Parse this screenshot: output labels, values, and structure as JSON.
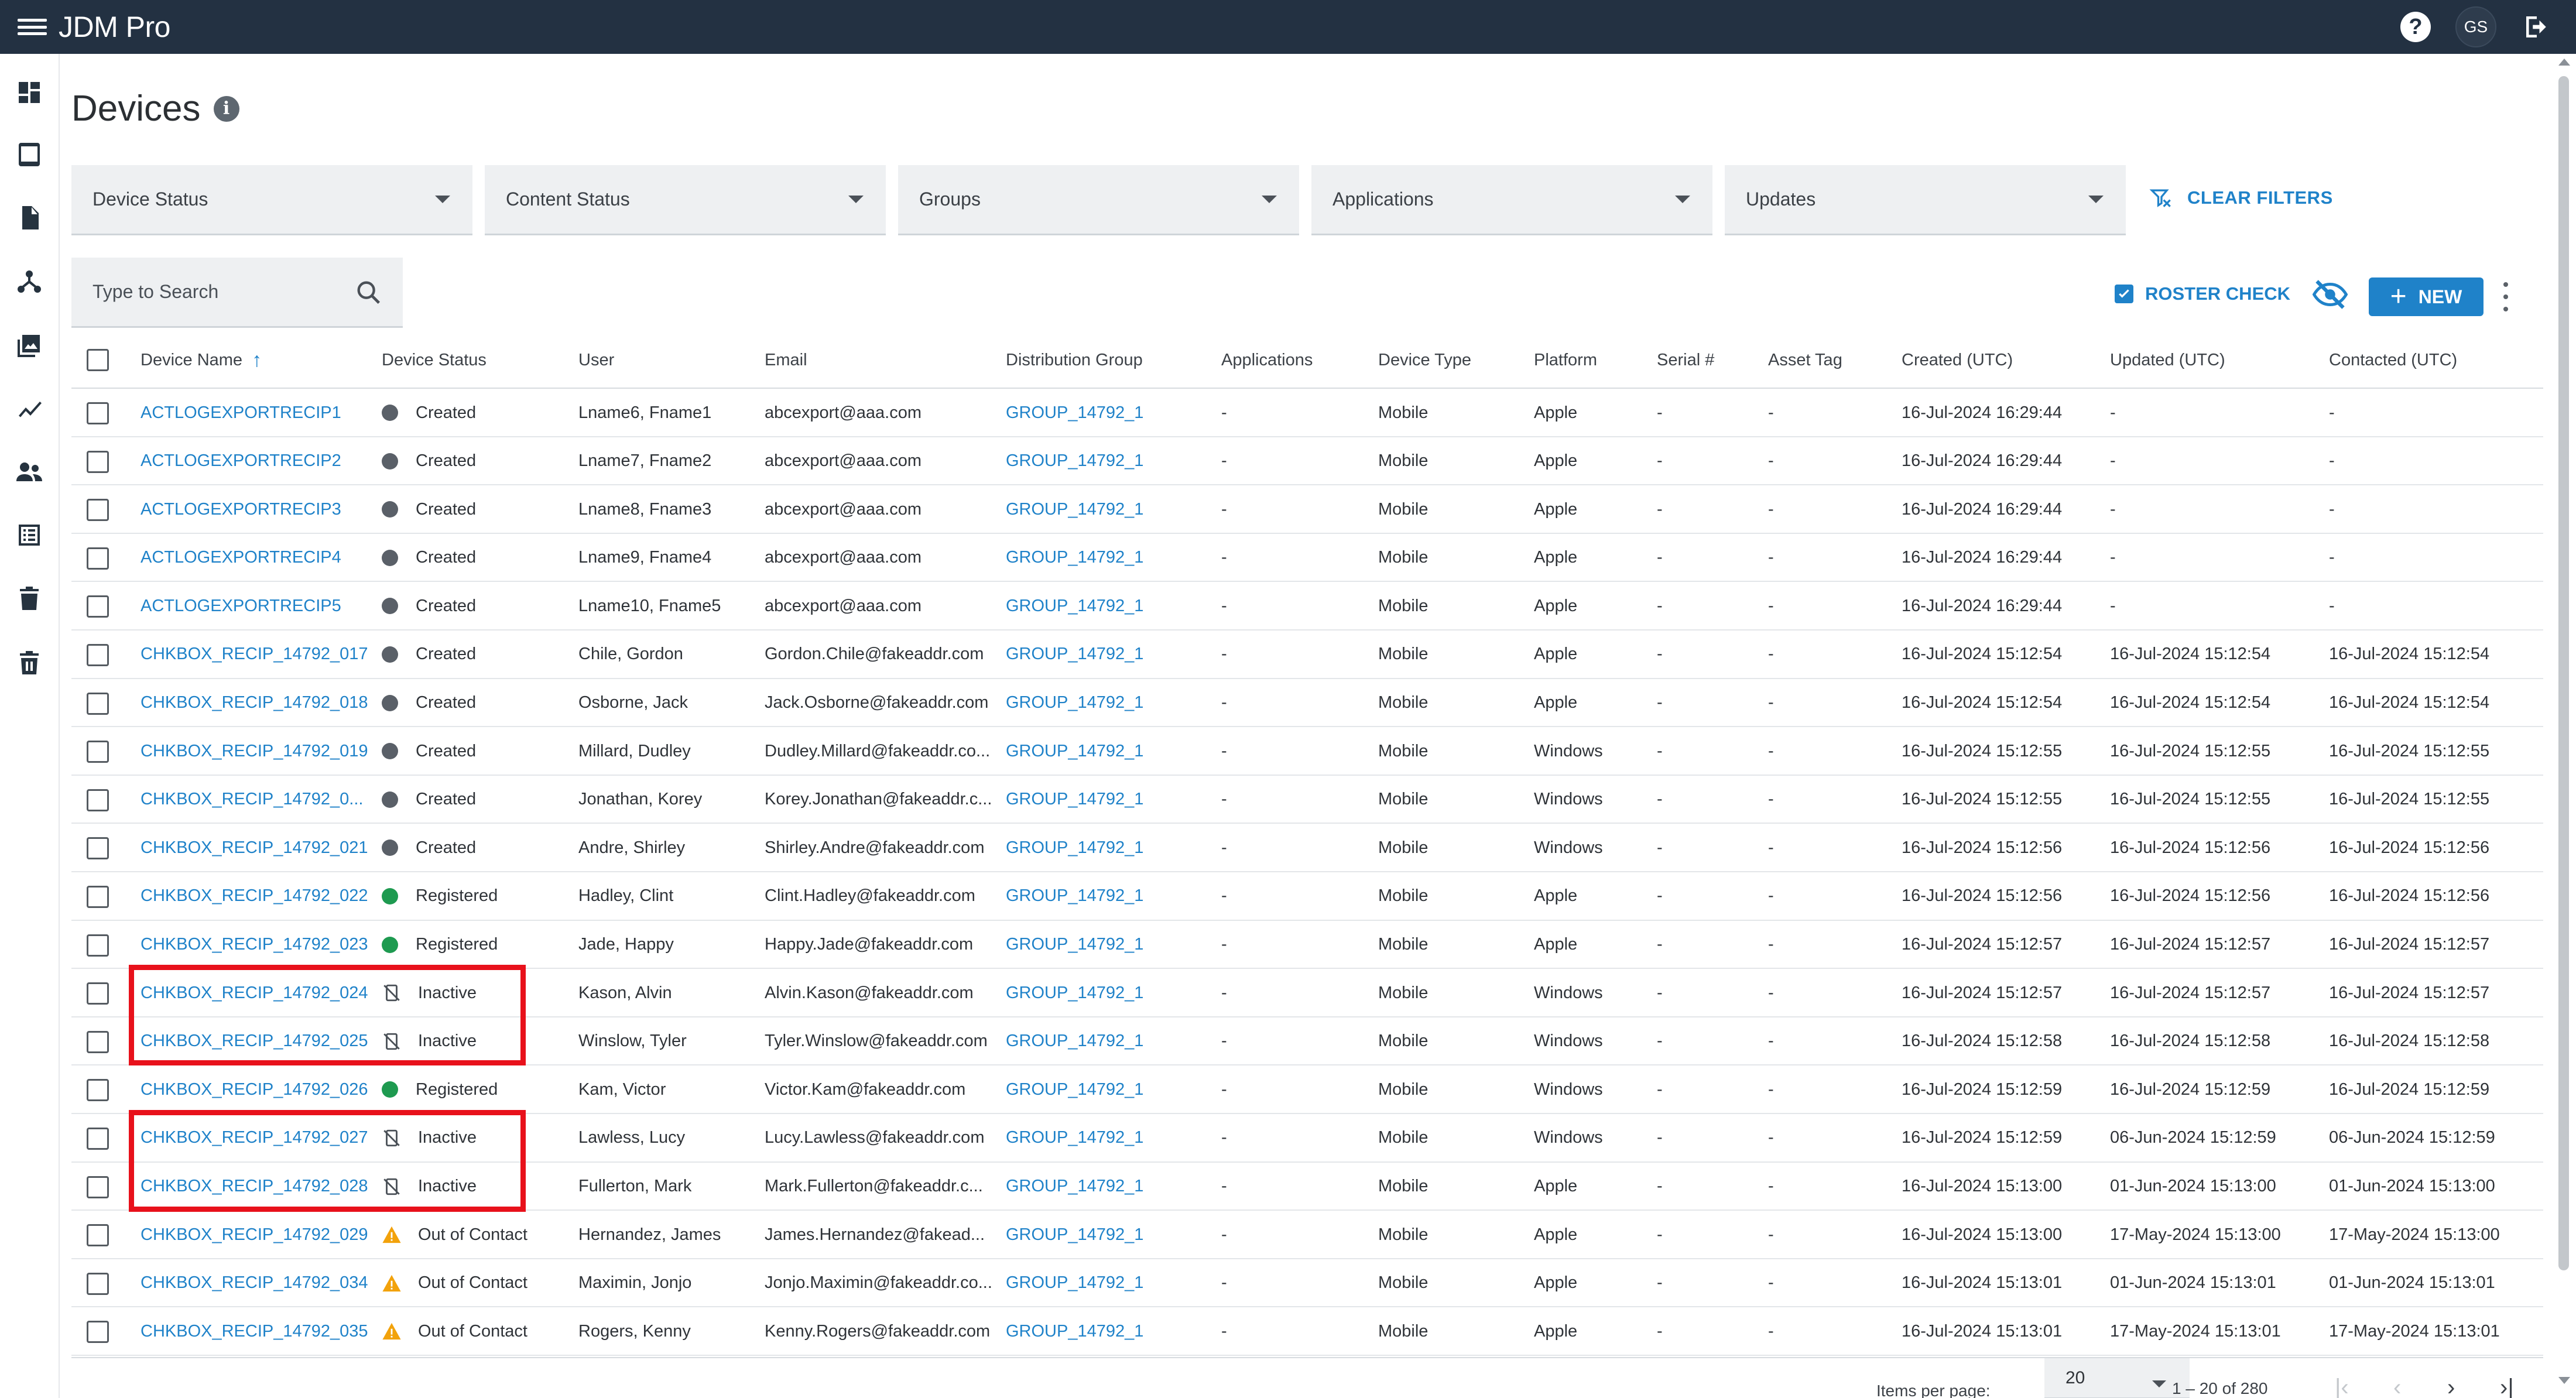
{
  "app": {
    "title": "JDM Pro",
    "avatar_initials": "GS"
  },
  "page": {
    "title": "Devices"
  },
  "filters": [
    {
      "label": "Device Status"
    },
    {
      "label": "Content Status"
    },
    {
      "label": "Groups"
    },
    {
      "label": "Applications"
    },
    {
      "label": "Updates"
    }
  ],
  "clear_filters_label": "CLEAR FILTERS",
  "search": {
    "placeholder": "Type to Search"
  },
  "toolbar": {
    "roster_check_label": "ROSTER CHECK",
    "new_label": "NEW"
  },
  "colors": {
    "accent": "#1f82c9",
    "topbar": "#233142",
    "created": "#5a6068",
    "registered": "#1e9a50",
    "warning": "#f2a20b",
    "highlight": "#e8111b"
  },
  "table": {
    "columns": [
      "Device Name",
      "Device Status",
      "User",
      "Email",
      "Distribution Group",
      "Applications",
      "Device Type",
      "Platform",
      "Serial #",
      "Asset Tag",
      "Created (UTC)",
      "Updated (UTC)",
      "Contacted (UTC)"
    ],
    "rows": [
      {
        "name": "ACTLOGEXPORTRECIP1",
        "status": "Created",
        "status_kind": "created",
        "user": "Lname6, Fname1",
        "email": "abcexport@aaa.com",
        "group": "GROUP_14792_1",
        "apps": "-",
        "type": "Mobile",
        "platform": "Apple",
        "serial": "-",
        "asset": "-",
        "created": "16-Jul-2024 16:29:44",
        "updated": "-",
        "contacted": "-"
      },
      {
        "name": "ACTLOGEXPORTRECIP2",
        "status": "Created",
        "status_kind": "created",
        "user": "Lname7, Fname2",
        "email": "abcexport@aaa.com",
        "group": "GROUP_14792_1",
        "apps": "-",
        "type": "Mobile",
        "platform": "Apple",
        "serial": "-",
        "asset": "-",
        "created": "16-Jul-2024 16:29:44",
        "updated": "-",
        "contacted": "-"
      },
      {
        "name": "ACTLOGEXPORTRECIP3",
        "status": "Created",
        "status_kind": "created",
        "user": "Lname8, Fname3",
        "email": "abcexport@aaa.com",
        "group": "GROUP_14792_1",
        "apps": "-",
        "type": "Mobile",
        "platform": "Apple",
        "serial": "-",
        "asset": "-",
        "created": "16-Jul-2024 16:29:44",
        "updated": "-",
        "contacted": "-"
      },
      {
        "name": "ACTLOGEXPORTRECIP4",
        "status": "Created",
        "status_kind": "created",
        "user": "Lname9, Fname4",
        "email": "abcexport@aaa.com",
        "group": "GROUP_14792_1",
        "apps": "-",
        "type": "Mobile",
        "platform": "Apple",
        "serial": "-",
        "asset": "-",
        "created": "16-Jul-2024 16:29:44",
        "updated": "-",
        "contacted": "-"
      },
      {
        "name": "ACTLOGEXPORTRECIP5",
        "status": "Created",
        "status_kind": "created",
        "user": "Lname10, Fname5",
        "email": "abcexport@aaa.com",
        "group": "GROUP_14792_1",
        "apps": "-",
        "type": "Mobile",
        "platform": "Apple",
        "serial": "-",
        "asset": "-",
        "created": "16-Jul-2024 16:29:44",
        "updated": "-",
        "contacted": "-"
      },
      {
        "name": "CHKBOX_RECIP_14792_017",
        "status": "Created",
        "status_kind": "created",
        "user": "Chile, Gordon",
        "email": "Gordon.Chile@fakeaddr.com",
        "group": "GROUP_14792_1",
        "apps": "-",
        "type": "Mobile",
        "platform": "Apple",
        "serial": "-",
        "asset": "-",
        "created": "16-Jul-2024 15:12:54",
        "updated": "16-Jul-2024 15:12:54",
        "contacted": "16-Jul-2024 15:12:54"
      },
      {
        "name": "CHKBOX_RECIP_14792_018",
        "status": "Created",
        "status_kind": "created",
        "user": "Osborne, Jack",
        "email": "Jack.Osborne@fakeaddr.com",
        "group": "GROUP_14792_1",
        "apps": "-",
        "type": "Mobile",
        "platform": "Apple",
        "serial": "-",
        "asset": "-",
        "created": "16-Jul-2024 15:12:54",
        "updated": "16-Jul-2024 15:12:54",
        "contacted": "16-Jul-2024 15:12:54"
      },
      {
        "name": "CHKBOX_RECIP_14792_019",
        "status": "Created",
        "status_kind": "created",
        "user": "Millard, Dudley",
        "email": "Dudley.Millard@fakeaddr.co...",
        "group": "GROUP_14792_1",
        "apps": "-",
        "type": "Mobile",
        "platform": "Windows",
        "serial": "-",
        "asset": "-",
        "created": "16-Jul-2024 15:12:55",
        "updated": "16-Jul-2024 15:12:55",
        "contacted": "16-Jul-2024 15:12:55"
      },
      {
        "name": "CHKBOX_RECIP_14792_0...",
        "status": "Created",
        "status_kind": "created",
        "user": "Jonathan, Korey",
        "email": "Korey.Jonathan@fakeaddr.c...",
        "group": "GROUP_14792_1",
        "apps": "-",
        "type": "Mobile",
        "platform": "Windows",
        "serial": "-",
        "asset": "-",
        "created": "16-Jul-2024 15:12:55",
        "updated": "16-Jul-2024 15:12:55",
        "contacted": "16-Jul-2024 15:12:55"
      },
      {
        "name": "CHKBOX_RECIP_14792_021",
        "status": "Created",
        "status_kind": "created",
        "user": "Andre, Shirley",
        "email": "Shirley.Andre@fakeaddr.com",
        "group": "GROUP_14792_1",
        "apps": "-",
        "type": "Mobile",
        "platform": "Windows",
        "serial": "-",
        "asset": "-",
        "created": "16-Jul-2024 15:12:56",
        "updated": "16-Jul-2024 15:12:56",
        "contacted": "16-Jul-2024 15:12:56"
      },
      {
        "name": "CHKBOX_RECIP_14792_022",
        "status": "Registered",
        "status_kind": "registered",
        "user": "Hadley, Clint",
        "email": "Clint.Hadley@fakeaddr.com",
        "group": "GROUP_14792_1",
        "apps": "-",
        "type": "Mobile",
        "platform": "Apple",
        "serial": "-",
        "asset": "-",
        "created": "16-Jul-2024 15:12:56",
        "updated": "16-Jul-2024 15:12:56",
        "contacted": "16-Jul-2024 15:12:56"
      },
      {
        "name": "CHKBOX_RECIP_14792_023",
        "status": "Registered",
        "status_kind": "registered",
        "user": "Jade, Happy",
        "email": "Happy.Jade@fakeaddr.com",
        "group": "GROUP_14792_1",
        "apps": "-",
        "type": "Mobile",
        "platform": "Apple",
        "serial": "-",
        "asset": "-",
        "created": "16-Jul-2024 15:12:57",
        "updated": "16-Jul-2024 15:12:57",
        "contacted": "16-Jul-2024 15:12:57"
      },
      {
        "name": "CHKBOX_RECIP_14792_024",
        "status": "Inactive",
        "status_kind": "inactive",
        "user": "Kason, Alvin",
        "email": "Alvin.Kason@fakeaddr.com",
        "group": "GROUP_14792_1",
        "apps": "-",
        "type": "Mobile",
        "platform": "Windows",
        "serial": "-",
        "asset": "-",
        "created": "16-Jul-2024 15:12:57",
        "updated": "16-Jul-2024 15:12:57",
        "contacted": "16-Jul-2024 15:12:57"
      },
      {
        "name": "CHKBOX_RECIP_14792_025",
        "status": "Inactive",
        "status_kind": "inactive",
        "user": "Winslow, Tyler",
        "email": "Tyler.Winslow@fakeaddr.com",
        "group": "GROUP_14792_1",
        "apps": "-",
        "type": "Mobile",
        "platform": "Windows",
        "serial": "-",
        "asset": "-",
        "created": "16-Jul-2024 15:12:58",
        "updated": "16-Jul-2024 15:12:58",
        "contacted": "16-Jul-2024 15:12:58"
      },
      {
        "name": "CHKBOX_RECIP_14792_026",
        "status": "Registered",
        "status_kind": "registered",
        "user": "Kam, Victor",
        "email": "Victor.Kam@fakeaddr.com",
        "group": "GROUP_14792_1",
        "apps": "-",
        "type": "Mobile",
        "platform": "Windows",
        "serial": "-",
        "asset": "-",
        "created": "16-Jul-2024 15:12:59",
        "updated": "16-Jul-2024 15:12:59",
        "contacted": "16-Jul-2024 15:12:59"
      },
      {
        "name": "CHKBOX_RECIP_14792_027",
        "status": "Inactive",
        "status_kind": "inactive",
        "user": "Lawless, Lucy",
        "email": "Lucy.Lawless@fakeaddr.com",
        "group": "GROUP_14792_1",
        "apps": "-",
        "type": "Mobile",
        "platform": "Windows",
        "serial": "-",
        "asset": "-",
        "created": "16-Jul-2024 15:12:59",
        "updated": "06-Jun-2024 15:12:59",
        "contacted": "06-Jun-2024 15:12:59"
      },
      {
        "name": "CHKBOX_RECIP_14792_028",
        "status": "Inactive",
        "status_kind": "inactive",
        "user": "Fullerton, Mark",
        "email": "Mark.Fullerton@fakeaddr.c...",
        "group": "GROUP_14792_1",
        "apps": "-",
        "type": "Mobile",
        "platform": "Apple",
        "serial": "-",
        "asset": "-",
        "created": "16-Jul-2024 15:13:00",
        "updated": "01-Jun-2024 15:13:00",
        "contacted": "01-Jun-2024 15:13:00"
      },
      {
        "name": "CHKBOX_RECIP_14792_029",
        "status": "Out of Contact",
        "status_kind": "warning",
        "user": "Hernandez, James",
        "email": "James.Hernandez@fakead...",
        "group": "GROUP_14792_1",
        "apps": "-",
        "type": "Mobile",
        "platform": "Apple",
        "serial": "-",
        "asset": "-",
        "created": "16-Jul-2024 15:13:00",
        "updated": "17-May-2024 15:13:00",
        "contacted": "17-May-2024 15:13:00"
      },
      {
        "name": "CHKBOX_RECIP_14792_034",
        "status": "Out of Contact",
        "status_kind": "warning",
        "user": "Maximin, Jonjo",
        "email": "Jonjo.Maximin@fakeaddr.co...",
        "group": "GROUP_14792_1",
        "apps": "-",
        "type": "Mobile",
        "platform": "Apple",
        "serial": "-",
        "asset": "-",
        "created": "16-Jul-2024 15:13:01",
        "updated": "01-Jun-2024 15:13:01",
        "contacted": "01-Jun-2024 15:13:01"
      },
      {
        "name": "CHKBOX_RECIP_14792_035",
        "status": "Out of Contact",
        "status_kind": "warning",
        "user": "Rogers, Kenny",
        "email": "Kenny.Rogers@fakeaddr.com",
        "group": "GROUP_14792_1",
        "apps": "-",
        "type": "Mobile",
        "platform": "Apple",
        "serial": "-",
        "asset": "-",
        "created": "16-Jul-2024 15:13:01",
        "updated": "17-May-2024 15:13:01",
        "contacted": "17-May-2024 15:13:01"
      }
    ]
  },
  "pagination": {
    "items_per_page_label": "Items per page:",
    "items_per_page": "20",
    "range": "1 – 20 of 280"
  },
  "icons": {
    "sidebar": [
      "dashboard-icon",
      "tablet-icon",
      "document-icon",
      "hierarchy-icon",
      "media-icon",
      "analytics-icon",
      "users-icon",
      "list-icon",
      "trash-icon",
      "trash-alt-icon"
    ],
    "status": {
      "created": "dot",
      "registered": "dot",
      "inactive": "device-off-icon",
      "warning": "warning-icon"
    }
  }
}
